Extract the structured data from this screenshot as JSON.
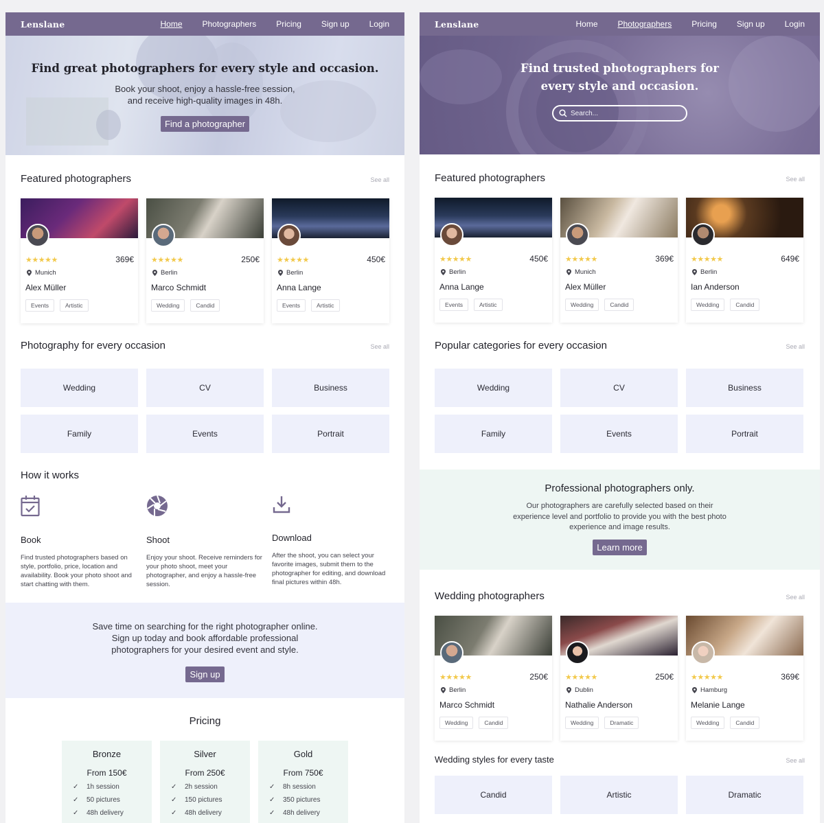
{
  "left": {
    "logo": "Lenslane",
    "nav": [
      {
        "label": "Home"
      },
      {
        "label": "Photographers"
      },
      {
        "label": "Pricing"
      },
      {
        "label": "Sign up"
      },
      {
        "label": "Login"
      }
    ],
    "hero": {
      "title": "Find great photographers for every style and occasion.",
      "subtitle_line1": "Book your shoot, enjoy a hassle-free session,",
      "subtitle_line2": "and receive high-quality images in 48h.",
      "button": "Find a photographer"
    },
    "featured": {
      "title": "Featured photographers",
      "see_all": "See all",
      "cards": [
        {
          "rating": "★★★★★",
          "price": "369€",
          "location": "Munich",
          "name": "Alex Müller",
          "tags": [
            "Events",
            "Artistic"
          ]
        },
        {
          "rating": "★★★★★",
          "price": "250€",
          "location": "Berlin",
          "name": "Marco Schmidt",
          "tags": [
            "Wedding",
            "Candid"
          ]
        },
        {
          "rating": "★★★★★",
          "price": "450€",
          "location": "Berlin",
          "name": "Anna Lange",
          "tags": [
            "Events",
            "Artistic"
          ]
        }
      ]
    },
    "occasions": {
      "title": "Photography for every occasion",
      "see_all": "See all",
      "items": [
        "Wedding",
        "CV",
        "Business",
        "Family",
        "Events",
        "Portrait"
      ]
    },
    "how": {
      "title": "How it works",
      "steps": [
        {
          "icon": "calendar-check-icon",
          "title": "Book",
          "text": "Find trusted photographers based on style, portfolio, price, location and availability. Book your photo shoot and start chatting with them."
        },
        {
          "icon": "camera-shutter-icon",
          "title": "Shoot",
          "text": "Enjoy your shoot. Receive reminders for your photo shoot, meet your photographer, and enjoy a hassle-free session."
        },
        {
          "icon": "download-icon",
          "title": "Download",
          "text": "After the shoot, you can select your favorite images, submit them to the photographer for editing, and download final pictures within 48h."
        }
      ]
    },
    "signup_banner": {
      "line1": "Save time on searching for the right photographer online.",
      "line2": "Sign up today and book affordable professional",
      "line3": "photographers for your desired event and style.",
      "button": "Sign up"
    },
    "pricing": {
      "title": "Pricing",
      "plans": [
        {
          "name": "Bronze",
          "price": "From 150€",
          "features": [
            "1h session",
            "50 pictures",
            "48h delivery"
          ]
        },
        {
          "name": "Silver",
          "price": "From 250€",
          "features": [
            "2h session",
            "150 pictures",
            "48h delivery"
          ]
        },
        {
          "name": "Gold",
          "price": "From 750€",
          "features": [
            "8h session",
            "350 pictures",
            "48h delivery"
          ]
        }
      ]
    }
  },
  "right": {
    "logo": "Lenslane",
    "nav": [
      {
        "label": "Home"
      },
      {
        "label": "Photographers"
      },
      {
        "label": "Pricing"
      },
      {
        "label": "Sign up"
      },
      {
        "label": "Login"
      }
    ],
    "hero": {
      "title_line1": "Find trusted photographers for",
      "title_line2": "every style and occasion.",
      "search_placeholder": "Search..."
    },
    "featured": {
      "title": "Featured photographers",
      "see_all": "See all",
      "cards": [
        {
          "rating": "★★★★★",
          "price": "450€",
          "location": "Berlin",
          "name": "Anna Lange",
          "tags": [
            "Events",
            "Artistic"
          ]
        },
        {
          "rating": "★★★★★",
          "price": "369€",
          "location": "Munich",
          "name": "Alex Müller",
          "tags": [
            "Wedding",
            "Candid"
          ]
        },
        {
          "rating": "★★★★★",
          "price": "649€",
          "location": "Berlin",
          "name": "Ian Anderson",
          "tags": [
            "Wedding",
            "Candid"
          ]
        }
      ]
    },
    "categories": {
      "title": "Popular categories for every occasion",
      "see_all": "See all",
      "items": [
        "Wedding",
        "CV",
        "Business",
        "Family",
        "Events",
        "Portrait"
      ]
    },
    "pro_banner": {
      "title": "Professional photographers only.",
      "line1": "Our photographers are carefully selected based on their",
      "line2": "experience level and portfolio to provide you with the best photo",
      "line3": "experience and image results.",
      "button": "Learn more"
    },
    "wedding": {
      "title": "Wedding photographers",
      "see_all": "See all",
      "cards": [
        {
          "rating": "★★★★★",
          "price": "250€",
          "location": "Berlin",
          "name": "Marco Schmidt",
          "tags": [
            "Wedding",
            "Candid"
          ]
        },
        {
          "rating": "★★★★★",
          "price": "250€",
          "location": "Dublin",
          "name": "Nathalie Anderson",
          "tags": [
            "Wedding",
            "Dramatic"
          ]
        },
        {
          "rating": "★★★★★",
          "price": "369€",
          "location": "Hamburg",
          "name": "Melanie Lange",
          "tags": [
            "Wedding",
            "Candid"
          ]
        }
      ]
    },
    "styles": {
      "title": "Wedding styles for every taste",
      "see_all": "See all",
      "items": [
        "Candid",
        "Artistic",
        "Dramatic"
      ]
    }
  },
  "colors": {
    "brand": "#75698f",
    "star": "#f2c94c",
    "category_bg": "#eef0fb",
    "pricing_bg": "#eef6f3"
  }
}
